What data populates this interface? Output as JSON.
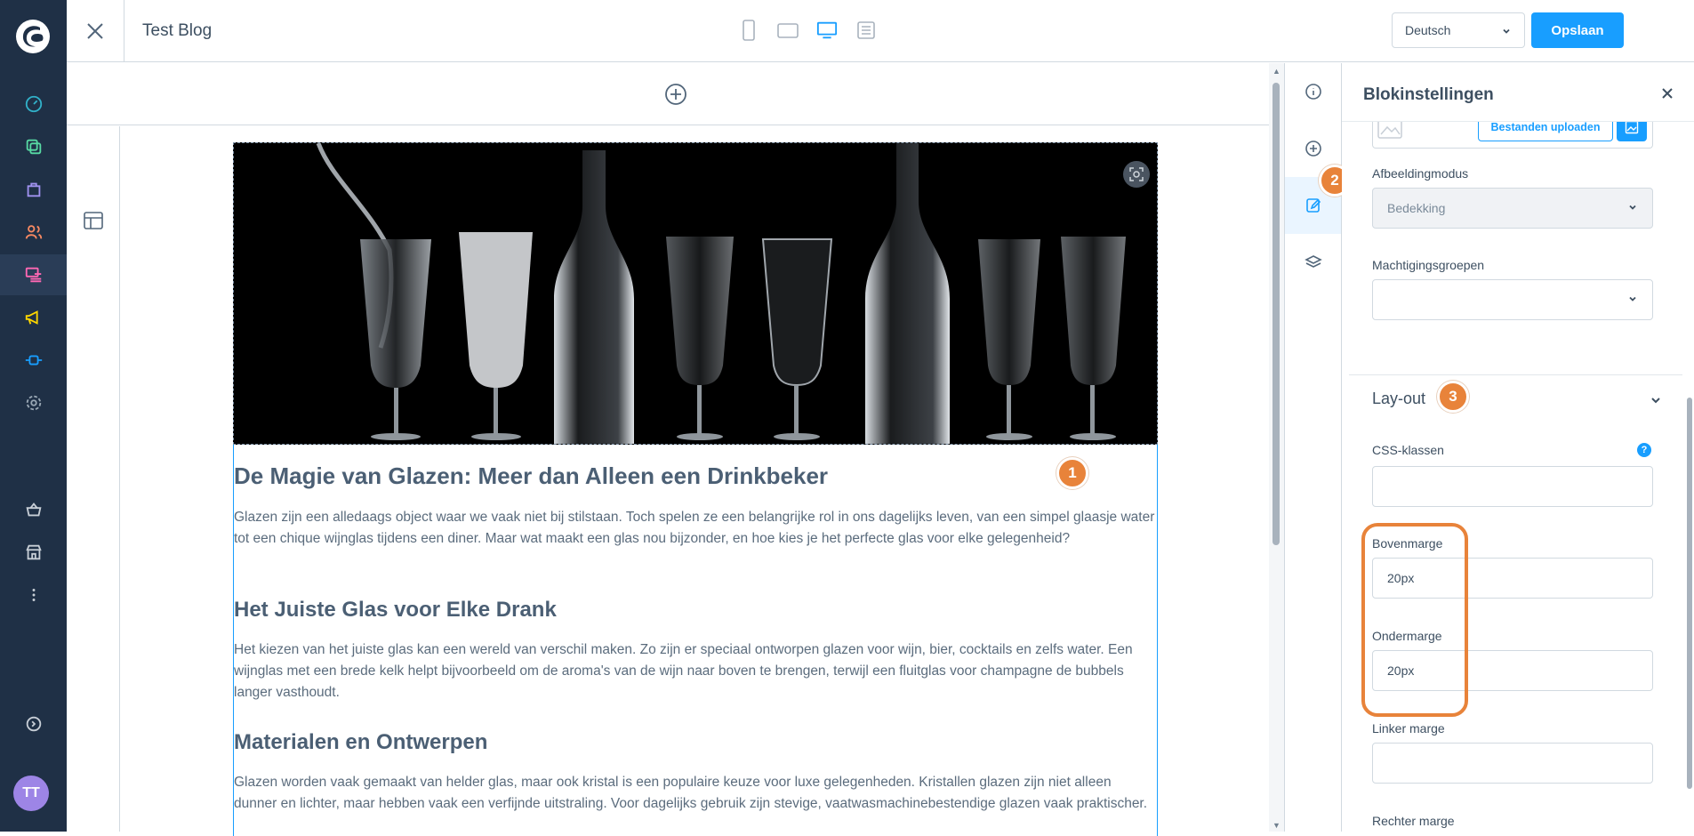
{
  "app": {
    "page_title": "Test Blog",
    "language": "Deutsch",
    "save_label": "Opslaan",
    "user_initials": "TT"
  },
  "sidebar": {
    "items": [
      {
        "icon": "dashboard-icon",
        "color": "#31b0c8"
      },
      {
        "icon": "catalogues-icon",
        "color": "#57d9a3"
      },
      {
        "icon": "orders-icon",
        "color": "#a092f0"
      },
      {
        "icon": "customers-icon",
        "color": "#f88962"
      },
      {
        "icon": "content-icon",
        "color": "#ff68b4"
      },
      {
        "icon": "marketing-icon",
        "color": "#ffd700"
      },
      {
        "icon": "extensions-icon",
        "color": "#189eff"
      },
      {
        "icon": "settings-icon",
        "color": "#9aa8b5"
      },
      {
        "icon": "sales-channel-basket-icon",
        "color": "#c7ced6"
      },
      {
        "icon": "sales-channel-store-icon",
        "color": "#c7ced6"
      },
      {
        "icon": "more-icon",
        "color": "#c7ced6"
      },
      {
        "icon": "collapse-icon",
        "color": "#c7ced6"
      }
    ]
  },
  "devices": [
    "mobile-icon",
    "tablet-icon",
    "desktop-icon",
    "list-icon"
  ],
  "content": {
    "heading": "De Magie van Glazen: Meer dan Alleen een Drinkbeker",
    "intro": "Glazen zijn een alledaags object waar we vaak niet bij stilstaan. Toch spelen ze een belangrijke rol in ons dagelijks leven, van een simpel glaasje water tot een chique wijnglas tijdens een diner. Maar wat maakt een glas nou bijzonder, en hoe kies je het perfecte glas voor elke gelegenheid?",
    "section1_title": "Het Juiste Glas voor Elke Drank",
    "section1_text": "Het kiezen van het juiste glas kan een wereld van verschil maken. Zo zijn er speciaal ontworpen glazen voor wijn, bier, cocktails en zelfs water. Een wijnglas met een brede kelk helpt bijvoorbeeld om de aroma's van de wijn naar boven te brengen, terwijl een fluitglas voor champagne de bubbels langer vasthoudt.",
    "section2_title": "Materialen en Ontwerpen",
    "section2_text": "Glazen worden vaak gemaakt van helder glas, maar ook kristal is een populaire keuze voor luxe gelegenheden. Kristallen glazen zijn niet alleen dunner en lichter, maar hebben vaak een verfijnde uitstraling. Voor dagelijks gebruik zijn stevige, vaatwasmachinebestendige glazen vaak praktischer."
  },
  "badges": {
    "one": "1",
    "two": "2",
    "three": "3"
  },
  "settings": {
    "title": "Blokinstellingen",
    "upload_label": "Bestanden uploaden",
    "image_mode_label": "Afbeeldingmodus",
    "image_mode_value": "Bedekking",
    "permission_groups_label": "Machtigingsgroepen",
    "permission_groups_value": "",
    "layout_title": "Lay-out",
    "css_classes_label": "CSS-klassen",
    "css_classes_value": "",
    "help_glyph": "?",
    "margin_top_label": "Bovenmarge",
    "margin_top_value": "20px",
    "margin_bottom_label": "Ondermarge",
    "margin_bottom_value": "20px",
    "margin_left_label": "Linker marge",
    "margin_left_value": "",
    "margin_right_label": "Rechter marge"
  },
  "colors": {
    "accent": "#189eff",
    "sidebar": "#1f3046",
    "highlight": "#e8833a"
  }
}
